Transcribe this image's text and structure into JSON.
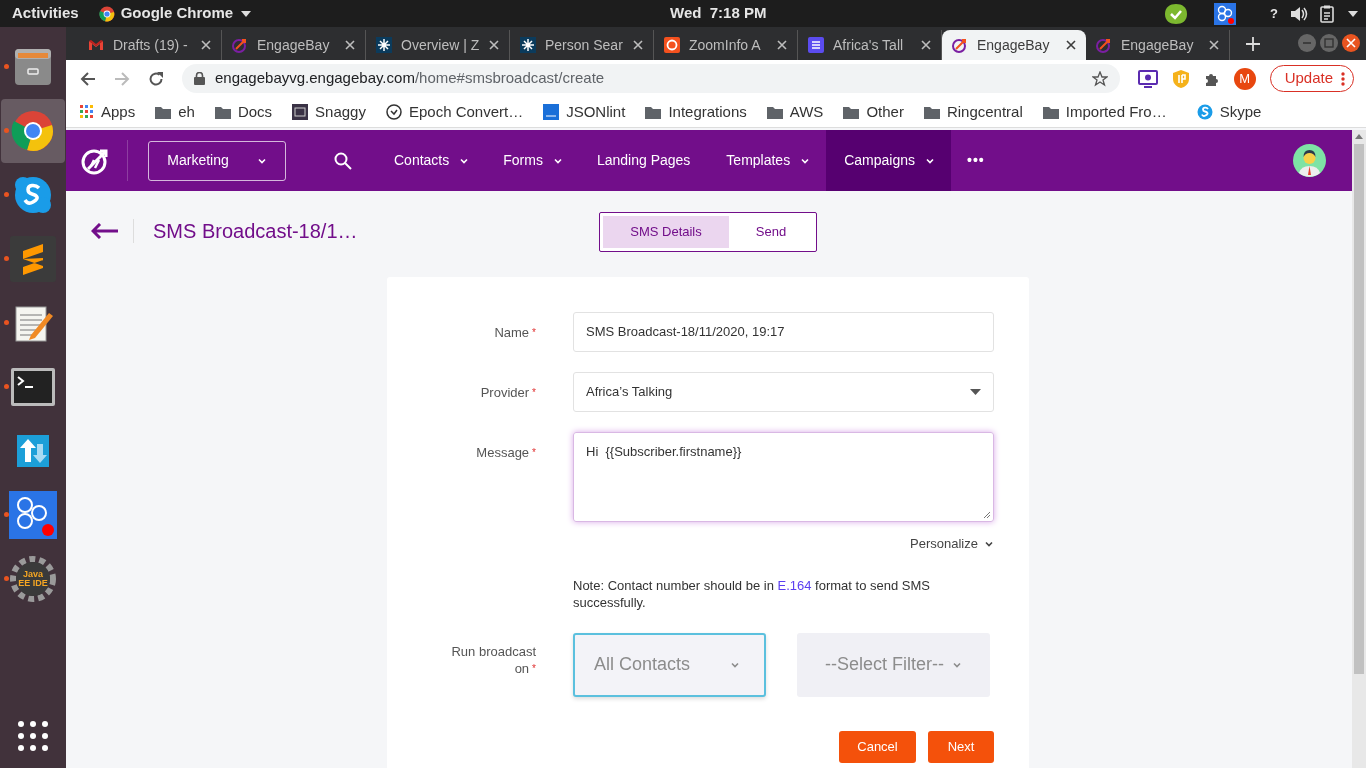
{
  "top_bar": {
    "activities": "Activities",
    "app_name": "Google Chrome",
    "clock": "Wed  7:18 PM",
    "help": "?"
  },
  "dock": [
    {
      "kind": "files",
      "running": true,
      "selected": false
    },
    {
      "kind": "chrome",
      "running": true,
      "selected": true
    },
    {
      "kind": "skype",
      "running": true,
      "selected": false
    },
    {
      "kind": "sublime",
      "running": true,
      "selected": false
    },
    {
      "kind": "editor",
      "running": true,
      "selected": false
    },
    {
      "kind": "terminal",
      "running": true,
      "selected": false
    },
    {
      "kind": "transfer",
      "running": false,
      "selected": false
    },
    {
      "kind": "hexagons",
      "running": true,
      "selected": false
    },
    {
      "kind": "gear",
      "running": true,
      "selected": false,
      "label": "Java EE IDE"
    }
  ],
  "browser_tabs": [
    {
      "title": "Drafts (19) -",
      "kind": "gmail",
      "selected": false
    },
    {
      "title": "EngageBay",
      "kind": "engagebay",
      "selected": false
    },
    {
      "title": "Overview | Z",
      "kind": "star",
      "selected": false
    },
    {
      "title": "Person Sear",
      "kind": "star",
      "selected": false
    },
    {
      "title": "ZoomInfo A",
      "kind": "zoom",
      "selected": false
    },
    {
      "title": "Africa's Tall",
      "kind": "doc",
      "selected": false
    },
    {
      "title": "EngageBay",
      "kind": "engagebay",
      "selected": true
    },
    {
      "title": "EngageBay",
      "kind": "engagebay",
      "selected": false
    }
  ],
  "address_bar": {
    "host": "engagebayvg.engagebay.com",
    "path": "/home#smsbroadcast/create"
  },
  "profile": "M",
  "update_button": "Update",
  "bookmarks": [
    {
      "kind": "apps",
      "label": "Apps"
    },
    {
      "kind": "folder",
      "label": "eh"
    },
    {
      "kind": "folder",
      "label": "Docs"
    },
    {
      "kind": "snaggy",
      "label": "Snaggy"
    },
    {
      "kind": "clock",
      "label": "Epoch Convert…"
    },
    {
      "kind": "json",
      "label": "JSONlint"
    },
    {
      "kind": "folder",
      "label": "Integrations"
    },
    {
      "kind": "folder",
      "label": "AWS"
    },
    {
      "kind": "folder",
      "label": "Other"
    },
    {
      "kind": "folder",
      "label": "Ringcentral"
    },
    {
      "kind": "folder",
      "label": "Imported Fro…"
    },
    {
      "kind": "skype",
      "label": "Skype"
    }
  ],
  "app_nav": {
    "module": "Marketing",
    "items": [
      {
        "label": "Contacts",
        "dropdown": true,
        "selected": false
      },
      {
        "label": "Forms",
        "dropdown": true,
        "selected": false
      },
      {
        "label": "Landing Pages",
        "dropdown": false,
        "selected": false
      },
      {
        "label": "Templates",
        "dropdown": true,
        "selected": false
      },
      {
        "label": "Campaigns",
        "dropdown": true,
        "selected": true
      }
    ],
    "more": "•••"
  },
  "page": {
    "title": "SMS Broadcast-18/1…",
    "steps": [
      {
        "label": "SMS Details",
        "selected": true
      },
      {
        "label": "Send",
        "selected": false
      }
    ]
  },
  "form": {
    "required_mark": "*",
    "fields": [
      {
        "label": "Name",
        "required": true,
        "kind": "text",
        "value": "SMS Broadcast-18/11/2020, 19:17"
      },
      {
        "label": "Provider",
        "required": true,
        "kind": "select",
        "value": "Africa’s Talking"
      },
      {
        "label": "Message",
        "required": true,
        "kind": "textarea",
        "value": "Hi  {{Subscriber.firstname}}"
      }
    ],
    "personalize": "Personalize",
    "note": {
      "before": "Note: Contact number should be in",
      "link": "E.164",
      "after": "format to send SMS successfully."
    },
    "run_on": {
      "label": "Run broadcast on",
      "required": true,
      "audience": "All Contacts",
      "filter": "--Select Filter--"
    },
    "buttons": [
      "Cancel",
      "Next"
    ]
  }
}
